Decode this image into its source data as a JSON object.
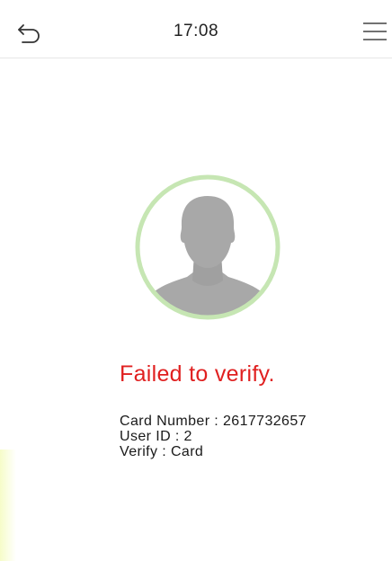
{
  "header": {
    "time": "17:08",
    "back_icon": "back-arrow-icon",
    "menu_icon": "hamburger-menu-icon"
  },
  "avatar": {
    "icon": "user-silhouette-icon",
    "ring_color": "#c6e6b3",
    "silhouette_color": "#a8a8a8"
  },
  "result": {
    "message": "Failed to verify.",
    "message_color": "#e02020"
  },
  "details": {
    "card_number": "Card Number : 2617732657",
    "user_id": "User ID : 2",
    "verify": "Verify : Card"
  }
}
